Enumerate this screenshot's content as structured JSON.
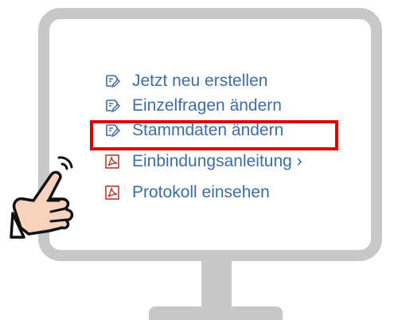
{
  "menu": {
    "items": [
      {
        "label": "Jetzt neu erstellen",
        "icon": "edit-form-icon"
      },
      {
        "label": "Einzelfragen ändern",
        "icon": "edit-form-icon"
      },
      {
        "label": "Stammdaten ändern",
        "icon": "edit-form-icon",
        "highlighted": true
      },
      {
        "label": "Einbindungsanleitung ›",
        "icon": "pdf-icon"
      },
      {
        "label": "Protokoll einsehen",
        "icon": "pdf-icon"
      }
    ]
  },
  "colors": {
    "link": "#3a6ea8",
    "highlight": "#e00000",
    "monitor": "#c8c8c8",
    "pdf_icon": "#c0392b"
  }
}
